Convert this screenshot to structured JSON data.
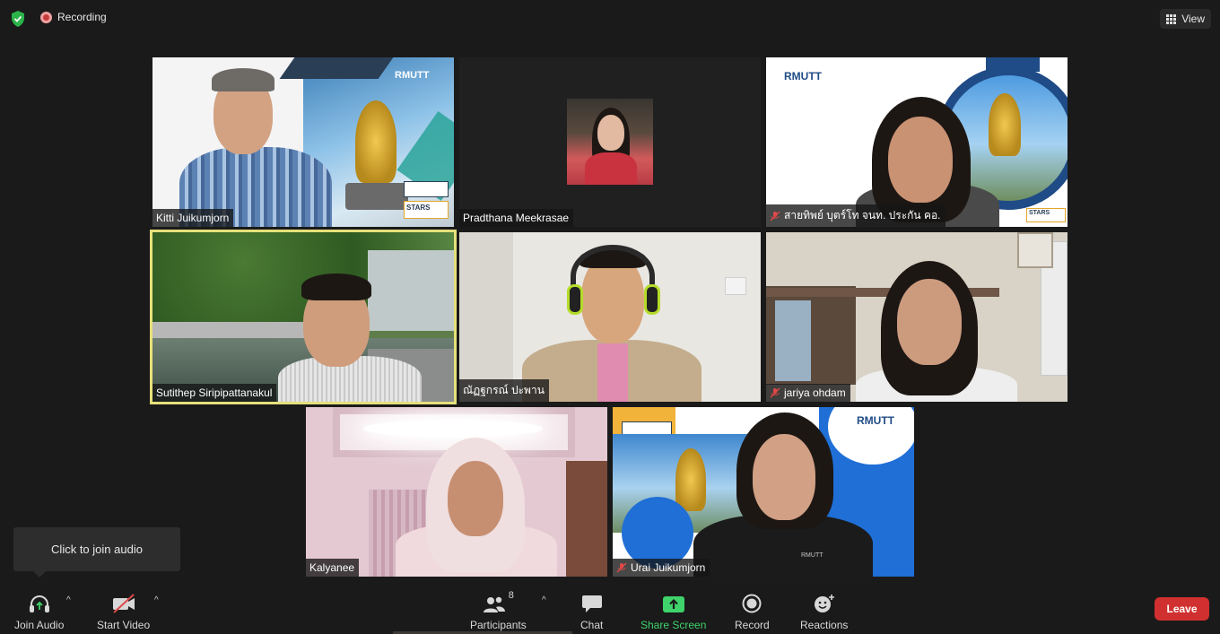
{
  "topbar": {
    "recording_label": "Recording",
    "view_label": "View"
  },
  "participants": [
    {
      "name": "Kitti Juikumjorn",
      "muted": false
    },
    {
      "name": "Pradthana Meekrasae",
      "muted": false
    },
    {
      "name": "สายทิพย์ บุตร์โท จนท. ประกัน คอ.",
      "muted": true
    },
    {
      "name": "Sutithep Siripipattanakul",
      "muted": false,
      "active_speaker": true
    },
    {
      "name": "ณัฏฐกรณ์ ปะพาน",
      "muted": false
    },
    {
      "name": "jariya ohdam",
      "muted": true
    },
    {
      "name": "Kalyanee",
      "muted": false
    },
    {
      "name": "Urai Juikumjorn",
      "muted": true
    }
  ],
  "tile_texts": {
    "rmutt": "RMUTT",
    "stars": "STARS",
    "stars_sub": "RATING SYSTEM",
    "shirt": "RMUTT"
  },
  "tooltip": "Click to join audio",
  "toolbar": {
    "join_audio": "Join Audio",
    "start_video": "Start Video",
    "participants": "Participants",
    "participants_count": "8",
    "chat": "Chat",
    "share_screen": "Share Screen",
    "record": "Record",
    "reactions": "Reactions",
    "leave": "Leave"
  },
  "colors": {
    "accent_green": "#3fd36b",
    "leave_red": "#d0302f",
    "active_speaker_border": "#e6e07a"
  }
}
